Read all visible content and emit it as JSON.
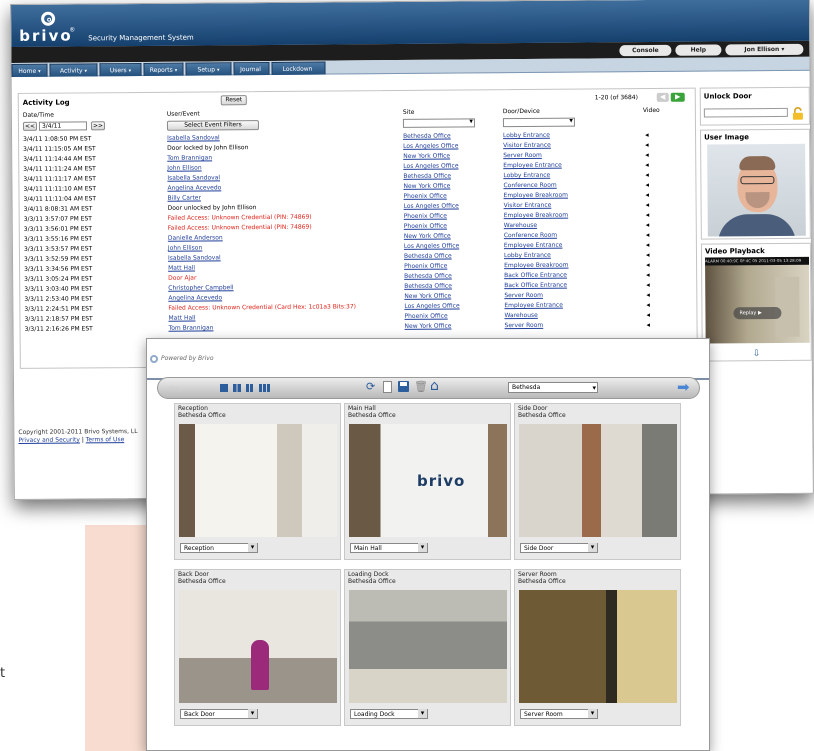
{
  "app": {
    "logo": "brivo",
    "logo_mark": "®",
    "subtitle": "Security Management System"
  },
  "userbar": {
    "console": "Console",
    "help": "Help",
    "user": "Jon Ellison ▾"
  },
  "nav": [
    {
      "label": "Home",
      "dd": "▾"
    },
    {
      "label": "Activity",
      "dd": "▾"
    },
    {
      "label": "Users",
      "dd": "▾"
    },
    {
      "label": "Reports",
      "dd": "▾"
    },
    {
      "label": "Setup",
      "dd": "▾"
    },
    {
      "label": "Journal",
      "dd": ""
    },
    {
      "label": "Lockdown",
      "dd": ""
    }
  ],
  "activity": {
    "title": "Activity Log",
    "reset": "Reset",
    "paging": "1-20 (of 3684)",
    "headers": {
      "date": "Date/Time",
      "user": "User/Event",
      "site": "Site",
      "door": "Door/Device",
      "video": "Video"
    },
    "date_value": "3/4/11",
    "prev": "<<",
    "next": ">>",
    "filter_btn": "Select Event Filters",
    "rows": [
      {
        "date": "3/4/11 1:08:50 PM EST",
        "event": "Isabella Sandoval",
        "type": "link",
        "site": "Bethesda Office",
        "door": "Lobby Entrance"
      },
      {
        "date": "3/4/11 11:15:05 AM EST",
        "event": "Door locked by John Ellison",
        "type": "plain",
        "site": "Los Angeles Office",
        "door": "Visitor Entrance"
      },
      {
        "date": "3/4/11 11:14:44 AM EST",
        "event": "Tom Brannigan",
        "type": "link",
        "site": "New York Office",
        "door": "Server Room"
      },
      {
        "date": "3/4/11 11:11:24 AM EST",
        "event": "John Ellison",
        "type": "link",
        "site": "Los Angeles Office",
        "door": "Employee Entrance"
      },
      {
        "date": "3/4/11 11:11:17 AM EST",
        "event": "Isabella Sandoval",
        "type": "link",
        "site": "Bethesda Office",
        "door": "Lobby Entrance"
      },
      {
        "date": "3/4/11 11:11:10 AM EST",
        "event": "Angelina Acevedo",
        "type": "link",
        "site": "New York Office",
        "door": "Conference Room"
      },
      {
        "date": "3/4/11 11:11:04 AM EST",
        "event": "Billy Carter",
        "type": "link",
        "site": "Phoenix Office",
        "door": "Employee Breakroom"
      },
      {
        "date": "3/4/11 8:08:31 AM EST",
        "event": "Door unlocked by John Ellison",
        "type": "plain",
        "site": "Los Angeles Office",
        "door": "Visitor Entrance"
      },
      {
        "date": "3/3/11 3:57:07 PM EST",
        "event": "Failed Access: Unknown Credential (PIN: 74869)",
        "type": "fail",
        "site": "Phoenix Office",
        "door": "Employee Breakroom"
      },
      {
        "date": "3/3/11 3:56:01 PM EST",
        "event": "Failed Access: Unknown Credential (PIN: 74869)",
        "type": "fail",
        "site": "Phoenix Office",
        "door": "Warehouse"
      },
      {
        "date": "3/3/11 3:55:16 PM EST",
        "event": "Danielle Anderson",
        "type": "link",
        "site": "New York Office",
        "door": "Conference Room"
      },
      {
        "date": "3/3/11 3:53:57 PM EST",
        "event": "John Ellison",
        "type": "link",
        "site": "Los Angeles Office",
        "door": "Employee Entrance"
      },
      {
        "date": "3/3/11 3:52:59 PM EST",
        "event": "Isabella Sandoval",
        "type": "link",
        "site": "Bethesda Office",
        "door": "Lobby Entrance"
      },
      {
        "date": "3/3/11 3:34:56 PM EST",
        "event": "Matt Hall",
        "type": "link",
        "site": "Phoenix Office",
        "door": "Employee Breakroom"
      },
      {
        "date": "3/3/11 3:05:24 PM EST",
        "event": "Door Ajar",
        "type": "fail",
        "site": "Bethesda Office",
        "door": "Back Office Entrance"
      },
      {
        "date": "3/3/11 3:03:40 PM EST",
        "event": "Christopher Campbell",
        "type": "link",
        "site": "Bethesda Office",
        "door": "Back Office Entrance"
      },
      {
        "date": "3/3/11 2:53:40 PM EST",
        "event": "Angelina Acevedo",
        "type": "link",
        "site": "New York Office",
        "door": "Server Room"
      },
      {
        "date": "3/3/11 2:24:51 PM EST",
        "event": "Failed Access: Unknown Credential (Card Hex: 1c01a3 Bits:37)",
        "type": "fail",
        "site": "Los Angeles Office",
        "door": "Employee Entrance"
      },
      {
        "date": "3/3/11 2:18:57 PM EST",
        "event": "Matt Hall",
        "type": "link",
        "site": "Phoenix Office",
        "door": "Warehouse"
      },
      {
        "date": "3/3/11 2:16:26 PM EST",
        "event": "Tom Brannigan",
        "type": "link",
        "site": "New York Office",
        "door": "Server Room"
      }
    ]
  },
  "right": {
    "unlock": "Unlock Door",
    "user_image": "User Image",
    "video": "Video Playback",
    "alarm": "ALARM 00:40:9C 0F:4C 05 2011-03-05 13:28:09",
    "replay": "Replay"
  },
  "footer": {
    "copyright": "Copyright 2001-2011 Brivo Systems, LL",
    "privacy": "Privacy and Security",
    "sep": "|",
    "terms": "Terms of Use"
  },
  "viewer": {
    "powered": "Powered by Brivo",
    "site_select": "Bethesda",
    "cameras": [
      {
        "name": "Reception",
        "site": "Bethesda Office",
        "select": "Reception"
      },
      {
        "name": "Main Hall",
        "site": "Bethesda Office",
        "select": "Main Hall"
      },
      {
        "name": "Side Door",
        "site": "Bethesda Office",
        "select": "Side Door"
      },
      {
        "name": "Back Door",
        "site": "Bethesda Office",
        "select": "Back Door"
      },
      {
        "name": "Loading Dock",
        "site": "Bethesda Office",
        "select": "Loading Dock"
      },
      {
        "name": "Server Room",
        "site": "Bethesda Office",
        "select": "Server Room"
      }
    ]
  },
  "side_text": "t",
  "colors": {
    "header": "#15406e",
    "nav": "#24507d",
    "link": "#203f9a",
    "fail": "#e0231a",
    "next_arrow": "#3aa33a",
    "viewer_arrow": "#4b86d6"
  }
}
